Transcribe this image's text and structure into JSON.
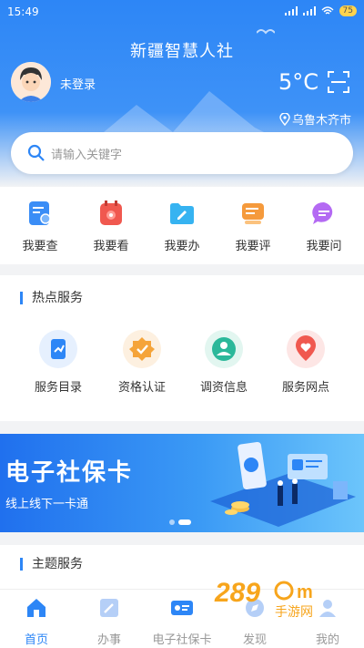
{
  "status": {
    "time": "15:49",
    "battery": "75"
  },
  "header": {
    "title": "新疆智慧人社",
    "login": "未登录",
    "temperature": "5°C",
    "location": "乌鲁木齐市"
  },
  "search": {
    "placeholder": "请输入关键字"
  },
  "quick": [
    {
      "label": "我要查",
      "icon": "search-doc-icon",
      "color": "#3a8df6"
    },
    {
      "label": "我要看",
      "icon": "calendar-icon",
      "color": "#f0584f"
    },
    {
      "label": "我要办",
      "icon": "folder-edit-icon",
      "color": "#36b3f1"
    },
    {
      "label": "我要评",
      "icon": "rating-icon",
      "color": "#f59a3c"
    },
    {
      "label": "我要问",
      "icon": "chat-icon",
      "color": "#b46af3"
    }
  ],
  "hot": {
    "title": "热点服务",
    "items": [
      {
        "label": "服务目录",
        "icon": "catalog-icon",
        "color": "#2d86f6",
        "bg": "#e6f0fe"
      },
      {
        "label": "资格认证",
        "icon": "certify-icon",
        "color": "#f5a43a",
        "bg": "#fdf0e0"
      },
      {
        "label": "调资信息",
        "icon": "person-icon",
        "color": "#2bb89a",
        "bg": "#e2f6f0"
      },
      {
        "label": "服务网点",
        "icon": "location-heart-icon",
        "color": "#f0584f",
        "bg": "#fde6e5"
      }
    ]
  },
  "banner": {
    "title": "电子社保卡",
    "subtitle": "线上线下一卡通"
  },
  "theme": {
    "title": "主题服务"
  },
  "tabs": [
    {
      "label": "首页",
      "icon": "home-icon",
      "active": true
    },
    {
      "label": "办事",
      "icon": "edit-icon",
      "active": false
    },
    {
      "label": "电子社保卡",
      "icon": "card-icon",
      "active": false
    },
    {
      "label": "发现",
      "icon": "discover-icon",
      "active": false
    },
    {
      "label": "我的",
      "icon": "user-icon",
      "active": false
    }
  ],
  "watermark": "289手游网",
  "colors": {
    "primary": "#2d86f6",
    "background": "#f2f3f5"
  }
}
